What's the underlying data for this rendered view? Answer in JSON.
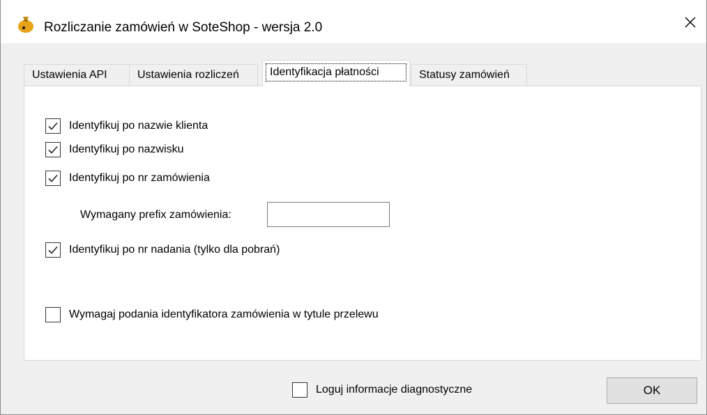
{
  "window": {
    "title": "Rozliczanie zamówień w SoteShop - wersja 2.0",
    "app_icon": "money-bag-icon",
    "close_icon": "close-icon"
  },
  "tabs": [
    {
      "label": "Ustawienia API",
      "active": false
    },
    {
      "label": "Ustawienia rozliczeń",
      "active": false
    },
    {
      "label": "Identyfikacja płatności",
      "active": true
    },
    {
      "label": "Statusy zamówień",
      "active": false
    }
  ],
  "options": [
    {
      "label": "Identyfikuj po nazwie klienta",
      "checked": true
    },
    {
      "label": "Identyfikuj po nazwisku",
      "checked": true
    },
    {
      "label": "Identyfikuj po nr zamówienia",
      "checked": true
    },
    {
      "label": "Identyfikuj po nr nadania (tylko dla pobrań)",
      "checked": true
    },
    {
      "label": "Wymagaj podania identyfikatora zamówienia w tytule przelewu",
      "checked": false
    }
  ],
  "prefix": {
    "label": "Wymagany prefix zamówienia:",
    "value": ""
  },
  "footer": {
    "diagnostics_label": "Loguj informacje diagnostyczne",
    "diagnostics_checked": false,
    "ok_label": "OK"
  },
  "colors": {
    "accent_icon": "#e8a317",
    "window_bg": "#f0f0f0"
  }
}
